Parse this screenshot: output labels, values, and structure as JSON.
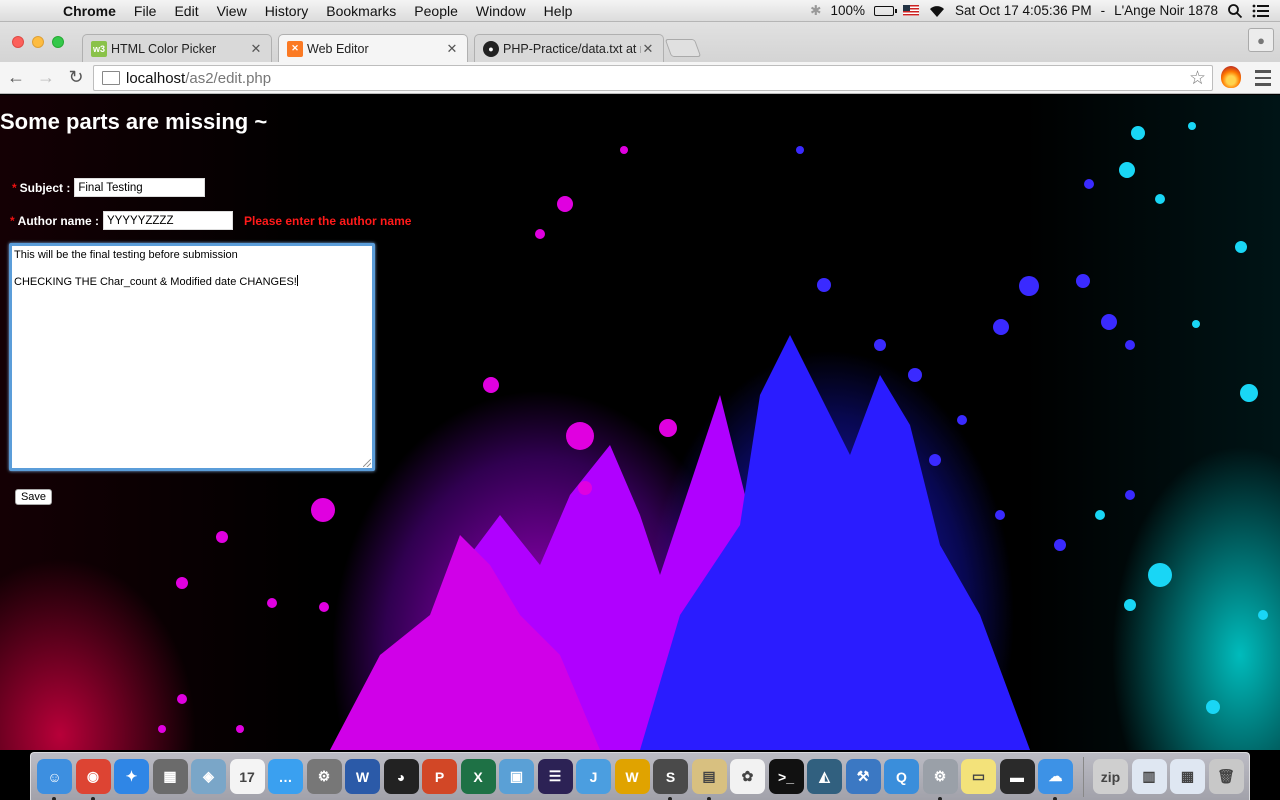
{
  "menubar": {
    "app_name": "Chrome",
    "items": [
      "File",
      "Edit",
      "View",
      "History",
      "Bookmarks",
      "People",
      "Window",
      "Help"
    ],
    "battery": "100%",
    "datetime": "Sat Oct 17  4:05:36 PM",
    "user": "L'Ange Noir 1878"
  },
  "tabs": [
    {
      "title": "HTML Color Picker",
      "favicon": "w3",
      "favicon_color": "#8ac249"
    },
    {
      "title": "Web Editor",
      "favicon": "xampp",
      "favicon_color": "#fb7a24"
    },
    {
      "title": "PHP-Practice/data.txt at m",
      "favicon": "github",
      "favicon_color": "#222222"
    }
  ],
  "address": {
    "host": "localhost",
    "path": "/as2/edit.php"
  },
  "page": {
    "heading": "Some parts are missing ~",
    "subject_label": "Subject :",
    "subject_value": "Final Testing",
    "author_label": "Author name :",
    "author_value": "YYYYYZZZZ",
    "author_error": "Please enter the author name",
    "required_marker": "*",
    "content_line1": "This will be the final testing before submission",
    "content_line2": "CHECKING THE Char_count & Modified date CHANGES!",
    "save_label": "Save",
    "error_color": "#ff1a1a"
  },
  "dock": {
    "apps": [
      {
        "name": "finder",
        "color": "#3d8fe0",
        "glyph": "☺",
        "running": true
      },
      {
        "name": "chrome",
        "color": "#dd4433",
        "glyph": "◉",
        "running": true
      },
      {
        "name": "safari",
        "color": "#2f86e6",
        "glyph": "✦",
        "running": false
      },
      {
        "name": "calculator",
        "color": "#6b6b6b",
        "glyph": "▦",
        "running": false
      },
      {
        "name": "preview",
        "color": "#7aa6c8",
        "glyph": "◈",
        "running": false
      },
      {
        "name": "calendar",
        "color": "#f4f4f4",
        "glyph": "17",
        "running": false
      },
      {
        "name": "messages",
        "color": "#3aa0f0",
        "glyph": "…",
        "running": false
      },
      {
        "name": "system-preferences",
        "color": "#777777",
        "glyph": "⚙",
        "running": false
      },
      {
        "name": "word",
        "color": "#2b5aa8",
        "glyph": "W",
        "running": false
      },
      {
        "name": "qq",
        "color": "#222222",
        "glyph": "◕",
        "running": false
      },
      {
        "name": "powerpoint",
        "color": "#d24726",
        "glyph": "P",
        "running": false
      },
      {
        "name": "excel",
        "color": "#1e7145",
        "glyph": "X",
        "running": false
      },
      {
        "name": "virtualbox",
        "color": "#5aa0d6",
        "glyph": "▣",
        "running": false
      },
      {
        "name": "eclipse",
        "color": "#2c2255",
        "glyph": "☰",
        "running": false
      },
      {
        "name": "jira",
        "color": "#4b9ee0",
        "glyph": "J",
        "running": false
      },
      {
        "name": "wunderlist",
        "color": "#e0a300",
        "glyph": "W",
        "running": false
      },
      {
        "name": "sublime-text",
        "color": "#4a4a4a",
        "glyph": "S",
        "running": true
      },
      {
        "name": "folder-notes",
        "color": "#d8c080",
        "glyph": "▤",
        "running": true
      },
      {
        "name": "photos",
        "color": "#f2f2f2",
        "glyph": "✿",
        "running": false
      },
      {
        "name": "terminal",
        "color": "#111111",
        "glyph": ">_",
        "running": false
      },
      {
        "name": "mysql-workbench",
        "color": "#31607f",
        "glyph": "◭",
        "running": false
      },
      {
        "name": "xcode",
        "color": "#3b78c3",
        "glyph": "⚒",
        "running": false
      },
      {
        "name": "quicktime",
        "color": "#3a8edb",
        "glyph": "Q",
        "running": false
      },
      {
        "name": "settings-gear",
        "color": "#9aa0a8",
        "glyph": "⚙",
        "running": true
      },
      {
        "name": "stickies",
        "color": "#f3e27a",
        "glyph": "▭",
        "running": false
      },
      {
        "name": "printer",
        "color": "#2a2a2a",
        "glyph": "▬",
        "running": false
      },
      {
        "name": "icloud",
        "color": "#3d92e6",
        "glyph": "☁",
        "running": true
      },
      {
        "name": "archive-utility",
        "color": "#cfcfcf",
        "glyph": "zip",
        "running": false
      },
      {
        "name": "desktop-folder",
        "color": "#dfe7f2",
        "glyph": "▥",
        "running": false
      },
      {
        "name": "downloads-folder",
        "color": "#dfe7f2",
        "glyph": "▦",
        "running": false
      },
      {
        "name": "trash",
        "color": "#c8c8c8",
        "glyph": "🗑",
        "running": false
      }
    ]
  }
}
